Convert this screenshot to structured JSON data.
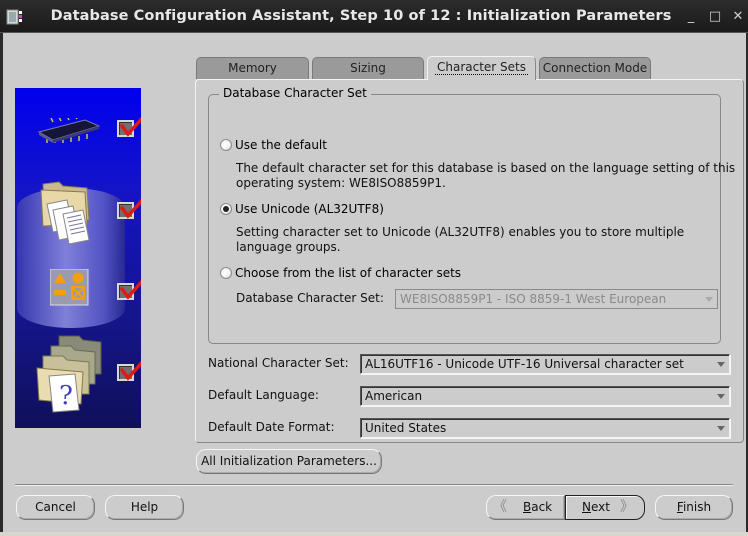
{
  "window": {
    "title": "Database Configuration Assistant, Step 10 of 12 : Initialization Parameters",
    "minimize_icon": "minimize-icon",
    "maximize_icon": "maximize-icon",
    "close_icon": "close-icon",
    "min_glyph": "_",
    "max_glyph": "□",
    "close_glyph": "✕"
  },
  "sidebar": {
    "steps": [
      {
        "icon": "memory-chip-icon",
        "checked": true
      },
      {
        "icon": "database-documents-icon",
        "checked": true
      },
      {
        "icon": "shapes-icon",
        "checked": true
      },
      {
        "icon": "folders-question-icon",
        "checked": true
      }
    ]
  },
  "tabs": [
    {
      "label": "Memory",
      "active": false
    },
    {
      "label": "Sizing",
      "active": false
    },
    {
      "label": "Character Sets",
      "active": true
    },
    {
      "label": "Connection Mode",
      "active": false
    }
  ],
  "character_sets": {
    "group_title": "Database Character Set",
    "options": [
      {
        "label": "Use the default",
        "selected": false,
        "description_line1": "The default character set for this database is based on the language setting of this",
        "description_line2": "operating system: WE8ISO8859P1."
      },
      {
        "label": "Use Unicode (AL32UTF8)",
        "selected": true,
        "description_line1": "Setting character set to Unicode (AL32UTF8) enables you to store multiple",
        "description_line2": "language groups."
      },
      {
        "label": "Choose from the list of character sets",
        "selected": false
      }
    ],
    "db_charset_label": "Database Character Set:",
    "db_charset_value": "WE8ISO8859P1 - ISO 8859-1 West European",
    "db_charset_disabled": true
  },
  "fields": {
    "national_label": "National Character Set:",
    "national_value": "AL16UTF16 - Unicode UTF-16 Universal character set",
    "language_label": "Default Language:",
    "language_value": "American",
    "date_format_label": "Default Date Format:",
    "date_format_value": "United States"
  },
  "buttons": {
    "all_params": "All Initialization Parameters...",
    "cancel": "Cancel",
    "help": "Help",
    "back_u": "B",
    "back_rest": "ack",
    "next_u": "N",
    "next_rest": "ext",
    "finish_u": "F",
    "finish_rest": "inish",
    "back_chevron": "《",
    "next_chevron": "》"
  }
}
